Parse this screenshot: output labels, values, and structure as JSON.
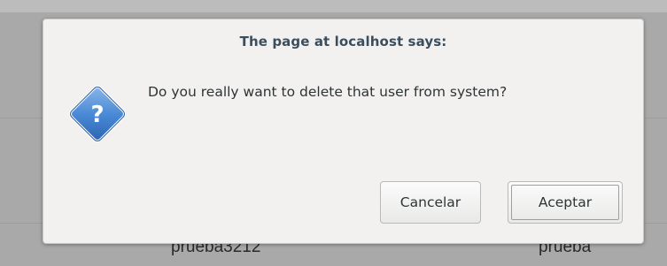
{
  "background": {
    "cells": [
      "prueba3212",
      "prueba"
    ]
  },
  "dialog": {
    "title": "The page at localhost says:",
    "message": "Do you really want to delete that user from system?",
    "icon": "question-icon",
    "buttons": {
      "cancel": "Cancelar",
      "accept": "Aceptar"
    }
  },
  "colors": {
    "title": "#3b4e5e",
    "icon_blue": "#3a7fd0",
    "dialog_bg": "#f2f1f0"
  }
}
